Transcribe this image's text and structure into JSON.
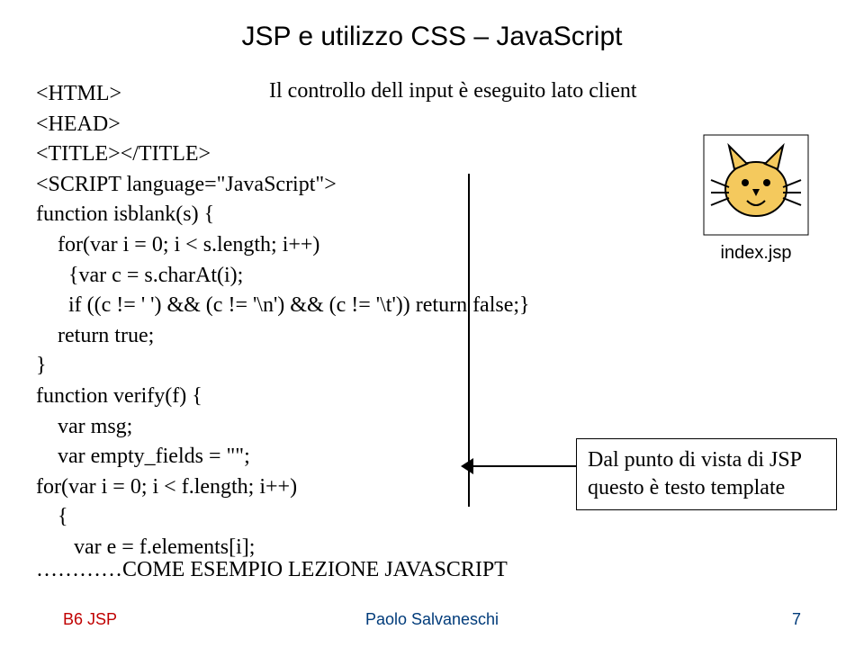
{
  "title": "JSP e utilizzo CSS – JavaScript",
  "subtitle": "Il controllo dell input è eseguito lato client",
  "code": [
    "<HTML>",
    "<HEAD>",
    "<TITLE></TITLE>",
    "<SCRIPT language=\"JavaScript\">",
    "function isblank(s) {",
    "    for(var i = 0; i < s.length; i++)",
    "      {var c = s.charAt(i);",
    "      if ((c != ' ') && (c != '\\n') && (c != '\\t')) return false;}",
    "    return true;",
    "}",
    "function verify(f) {",
    "    var msg;",
    "    var empty_fields = \"\";",
    "for(var i = 0; i < f.length; i++)",
    "    {",
    "       var e = f.elements[i];"
  ],
  "callout": {
    "line1": "Dal punto di vista di JSP",
    "line2": "questo è testo template"
  },
  "icon_label": "index.jsp",
  "example_line": "…………COME ESEMPIO LEZIONE JAVASCRIPT",
  "footer": {
    "left": "B6 JSP",
    "center": "Paolo Salvaneschi",
    "right": "7"
  }
}
